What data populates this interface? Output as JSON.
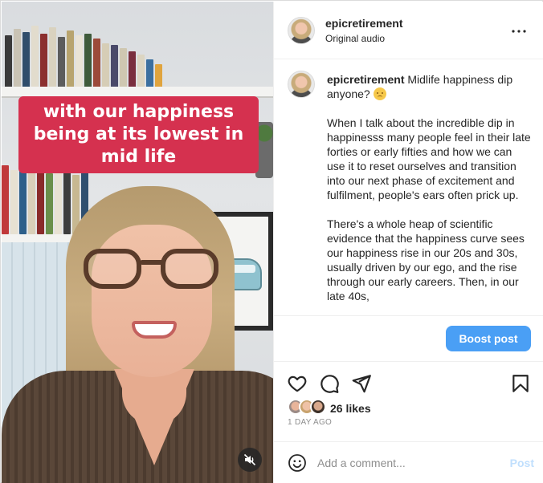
{
  "media": {
    "caption": "with our happiness\nbeing at its lowest in\nmid life",
    "mute_icon": "speaker-muted-icon"
  },
  "header": {
    "username": "epicretirement",
    "audio_label": "Original audio",
    "more_icon": "more-horizontal-icon"
  },
  "post": {
    "username": "epicretirement",
    "headline": "Midlife happiness dip anyone?",
    "emoji": "disappointed-face",
    "paragraphs": [
      "When I talk about the incredible dip in happinesss many people feel in their late forties or early fifties and how we can use it to reset ourselves and transition into our next phase of excitement and fulfilment, people's ears often prick up.",
      "There's a whole heap of scientific evidence that the happiness curve sees our happiness rise in our 20s and 30s, usually driven by our ego, and the rise through our early careers. Then, in our late 40s,"
    ]
  },
  "boost": {
    "label": "Boost post"
  },
  "actions": {
    "like_icon": "heart-icon",
    "comment_icon": "comment-icon",
    "share_icon": "paper-plane-icon",
    "save_icon": "bookmark-icon",
    "likes": "26 likes",
    "time_ago": "1 DAY AGO"
  },
  "comment": {
    "emoji_icon": "smiley-icon",
    "placeholder": "Add a comment...",
    "post_label": "Post"
  },
  "colors": {
    "caption_bg": "#d5314f",
    "boost_bg": "#4a9ff5",
    "post_disabled": "#c0dffd"
  }
}
